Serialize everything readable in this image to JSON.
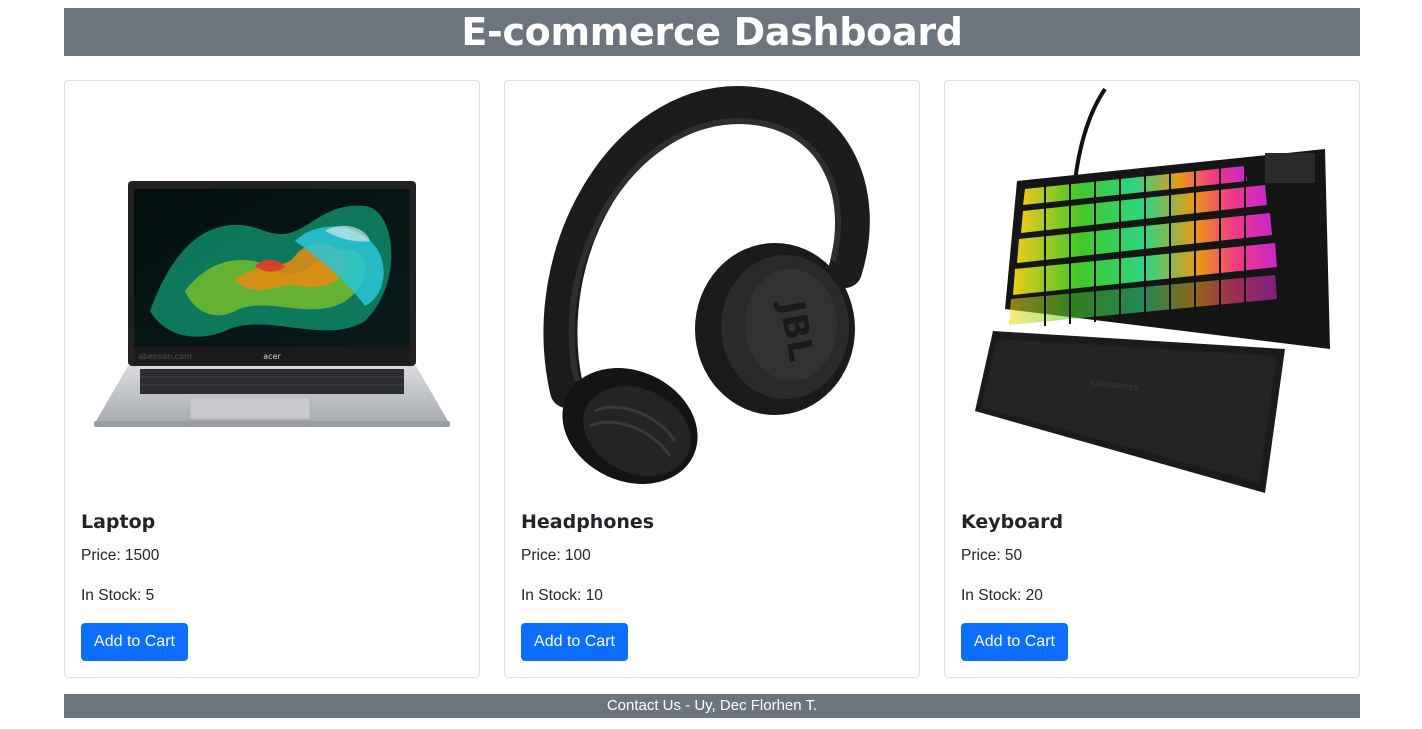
{
  "header": {
    "title": "E-commerce Dashboard"
  },
  "products": [
    {
      "name": "Laptop",
      "price_text": "Price: 1500",
      "stock_text": "In Stock: 5",
      "button_label": "Add to Cart",
      "image_brand": "acer",
      "image_watermark": "abenson.com"
    },
    {
      "name": "Headphones",
      "price_text": "Price: 100",
      "stock_text": "In Stock: 10",
      "button_label": "Add to Cart",
      "image_brand": "JBL"
    },
    {
      "name": "Keyboard",
      "price_text": "Price: 50",
      "stock_text": "In Stock: 20",
      "button_label": "Add to Cart",
      "image_brand": "steelseries"
    }
  ],
  "footer": {
    "text": "Contact Us - Uy, Dec Florhen T."
  },
  "colors": {
    "header_bg": "#6c757d",
    "button_bg": "#0d6efd"
  }
}
